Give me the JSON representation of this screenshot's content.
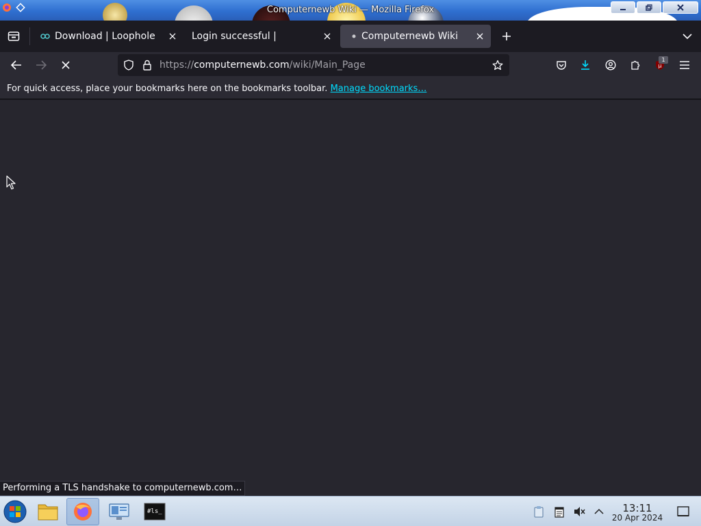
{
  "window": {
    "title": "Computernewb Wiki — Mozilla Firefox"
  },
  "tabs": [
    {
      "label": "Download | Loophole",
      "active": false
    },
    {
      "label": "Login successful |",
      "active": false
    },
    {
      "label": "Computernewb Wiki",
      "active": true
    }
  ],
  "navbar": {
    "url_scheme": "https://",
    "url_host": "computernewb.com",
    "url_path": "/wiki/Main_Page",
    "extension_badge": "1"
  },
  "bookmarks": {
    "message": "For quick access, place your bookmarks here on the bookmarks toolbar.",
    "manage_link": "Manage bookmarks…"
  },
  "status": {
    "text": "Performing a TLS handshake to computernewb.com…"
  },
  "taskbar": {
    "time": "13:11",
    "date": "20 Apr 2024"
  },
  "colors": {
    "toolbar": "#2b2a33",
    "tabbar": "#1c1b22",
    "active_tab": "#42414d",
    "link": "#00ddff",
    "download_icon": "#00ddff"
  }
}
